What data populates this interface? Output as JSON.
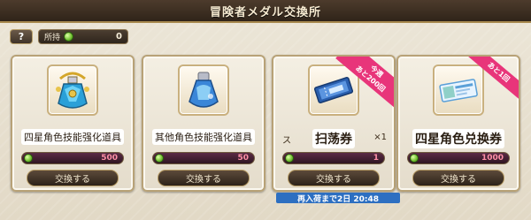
{
  "header": {
    "title": "冒険者メダル交換所"
  },
  "toolbar": {
    "help_label": "?",
    "owned_label": "所持",
    "owned_value": "0"
  },
  "items": [
    {
      "name": "四星角色技能强化道具",
      "price": "500",
      "button": "交換する",
      "icon": "blue-potion-gold-icon"
    },
    {
      "name": "其他角色技能强化道具",
      "price": "50",
      "button": "交換する",
      "icon": "blue-potion-icon"
    },
    {
      "name": "扫荡券",
      "name_prefix": "ス",
      "name_suffix": "×1",
      "price": "1",
      "button": "交換する",
      "icon": "ticket-icon",
      "ribbon": [
        "今週",
        "あと200回"
      ]
    },
    {
      "name": "四星角色兑换券",
      "price": "1000",
      "button": "交換する",
      "icon": "character-ticket-icon",
      "ribbon": [
        "あと1回"
      ]
    }
  ],
  "footer": {
    "restock_text": "再入荷まで2日 20:48"
  },
  "colors": {
    "ribbon": "#e8357a",
    "timer": "#2d6fc1",
    "price": "#ff8fa6"
  }
}
